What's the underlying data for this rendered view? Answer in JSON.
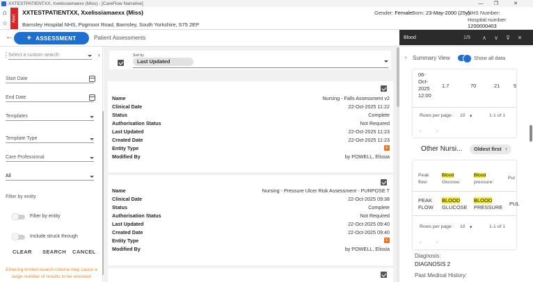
{
  "window": {
    "title": "XXTESTPATIENTXX, Xxelissiamaexx (Miss) - [CareFlow Narrative]"
  },
  "patient": {
    "name": "XXTESTPATIENTXX, Xxelissiamaexx (Miss)",
    "address": "Barnsley Hospital NHS, Pogmoor Road, Barnsley, South Yorkshire, S75 2EP",
    "alert_label": "Alert",
    "gender_label": "Gender:",
    "gender": "Female",
    "born_label": "Born:",
    "born": "23-May-2000 (25y)",
    "nhs_label": "NHS Number:",
    "nhs": "",
    "hospital_label": "Hospital number:",
    "hospital": "1200000403"
  },
  "toolbar": {
    "assessment_label": "ASSESSMENT",
    "breadcrumb": "Patient Assessments"
  },
  "find": {
    "query": "Blood",
    "count": "1/9"
  },
  "filters": {
    "search_placeholder": "Select a custom search",
    "start_date": "Start Date",
    "end_date": "End Date",
    "templates": "Templates",
    "template_type": "Template Type",
    "care_professional": "Care Professional",
    "all": "All",
    "filter_by_entity_heading": "Filter by entity",
    "filter_by_entity_toggle": "Filter by entity",
    "include_struck": "Include struck through",
    "clear": "CLEAR",
    "search": "SEARCH",
    "cancel": "CANCEL",
    "warning": "Entering limited search criteria may cause a large number of results to be returned"
  },
  "sort": {
    "label": "Sort by",
    "value": "Last Updated"
  },
  "labels": {
    "name": "Name",
    "clinical_date": "Clinical Date",
    "status": "Status",
    "authorisation_status": "Authorisation Status",
    "last_updated": "Last Updated",
    "created_date": "Created Date",
    "entity_type": "Entity Type",
    "modified_by": "Modified By"
  },
  "results": [
    {
      "name": "Nursing - Falls Assessment v2",
      "clinical_date": "22-Oct-2025 11:22",
      "status": "Complete",
      "authorisation_status": "Not Required",
      "last_updated": "22-Oct-2025 11:23",
      "created_date": "22-Oct-2025 11:23",
      "entity_badge": "E",
      "modified_by": "by POWELL, Elissia"
    },
    {
      "name": "Nursing - Pressure Ulcer Risk Assessment - PURPOSE T",
      "clinical_date": "22-Oct-2025 09:38",
      "status": "Complete",
      "authorisation_status": "Not Required",
      "last_updated": "22-Oct-2025 09:40",
      "created_date": "22-Oct-2025 09:40",
      "entity_badge": "E",
      "modified_by": "by POWELL, Elissia"
    }
  ],
  "summary": {
    "title": "Summary View",
    "show_all": "Show all data",
    "top_table": {
      "date": [
        "06-",
        "Oct-",
        "2025",
        "12:00"
      ],
      "values": [
        "1.7",
        "70",
        "21",
        "5"
      ],
      "rows_per_page_label": "Rows per page:",
      "rows_per_page": "10",
      "range": "1-1 of 1"
    },
    "other": {
      "title": "Other Nursi...",
      "sort": "Oldest first",
      "headers": [
        {
          "line1": "Peak",
          "line2": "flow:"
        },
        {
          "line1": "Blood",
          "line2": "Glucose:"
        },
        {
          "line1": "Blood",
          "line2": "pressure:"
        },
        {
          "line1": "Pul",
          "line2": ""
        }
      ],
      "values": [
        {
          "line1": "PEAK",
          "line2": "FLOW"
        },
        {
          "line1": "BLOOD",
          "line2": "GLUCOSE"
        },
        {
          "line1": "BLOOD",
          "line2": "PRESSURE"
        },
        {
          "line1": "PUL",
          "line2": ""
        }
      ],
      "rows_per_page_label": "Rows per page:",
      "rows_per_page": "10",
      "range": "1-1 of 1"
    },
    "diagnosis_label": "Diagnosis:",
    "diagnosis_value": "DIAGNOSIS 2",
    "pmh_label": "Past Medical History:"
  },
  "colors": {
    "accent": "#1f6fd1",
    "alert": "#d62828",
    "warning": "#f08a24",
    "highlight": "#f2ec2a",
    "entity": "#f06f1c"
  }
}
